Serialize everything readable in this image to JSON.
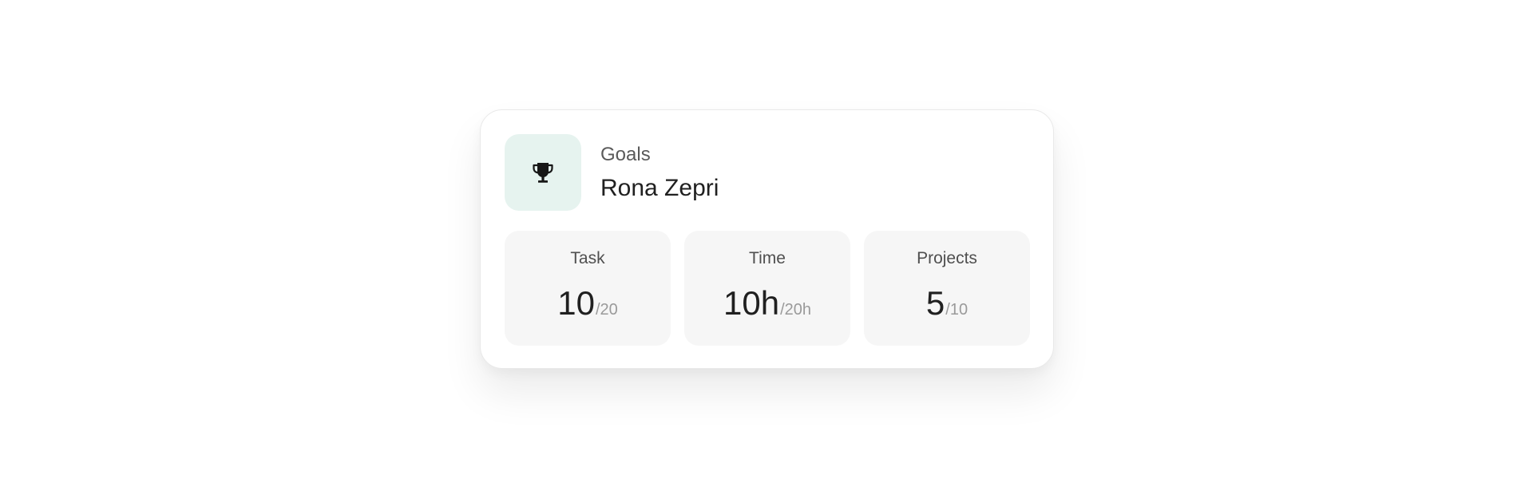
{
  "card": {
    "eyebrow": "Goals",
    "name": "Rona Zepri",
    "icon": "trophy-icon",
    "icon_background": "#e6f3ef"
  },
  "stats": [
    {
      "label": "Task",
      "current": "10",
      "total": "/20"
    },
    {
      "label": "Time",
      "current": "10h",
      "total": "/20h"
    },
    {
      "label": "Projects",
      "current": "5",
      "total": "/10"
    }
  ]
}
